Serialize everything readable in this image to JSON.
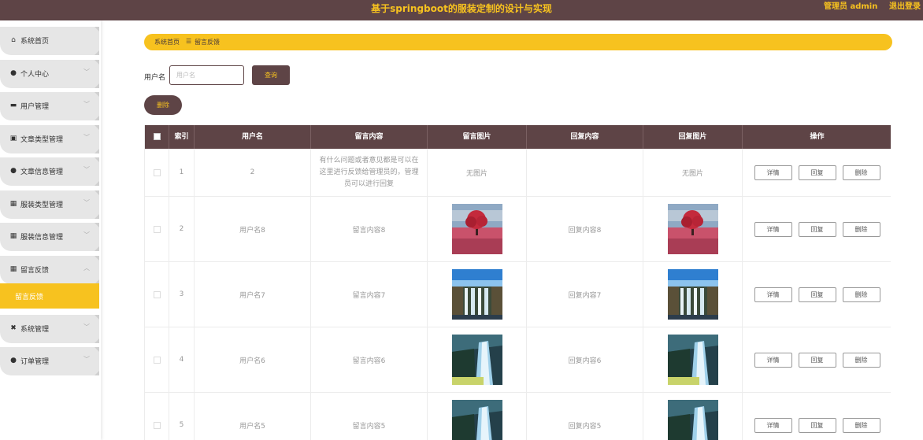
{
  "header": {
    "title": "基于springboot的服装定制的设计与实现",
    "admin": "管理员 admin",
    "logout": "退出登录"
  },
  "sidebar": {
    "items": [
      {
        "label": "系统首页",
        "icon": "home-icon",
        "chevron": ""
      },
      {
        "label": "个人中心",
        "icon": "user-icon",
        "chevron": "﹀"
      },
      {
        "label": "用户管理",
        "icon": "monitor-icon",
        "chevron": "﹀"
      },
      {
        "label": "文章类型管理",
        "icon": "briefcase-icon",
        "chevron": "﹀"
      },
      {
        "label": "文章信息管理",
        "icon": "user-icon",
        "chevron": "﹀"
      },
      {
        "label": "服装类型管理",
        "icon": "grid-icon",
        "chevron": "﹀"
      },
      {
        "label": "服装信息管理",
        "icon": "grid-icon",
        "chevron": "﹀"
      },
      {
        "label": "留言反馈",
        "icon": "grid-icon",
        "chevron": "︿"
      },
      {
        "label": "系统管理",
        "icon": "ticket-icon",
        "chevron": "﹀"
      },
      {
        "label": "订单管理",
        "icon": "pin-icon",
        "chevron": "﹀"
      }
    ],
    "active_sub": "留言反馈"
  },
  "breadcrumb": {
    "home": "系统首页",
    "sep": "☰",
    "current": "留言反馈"
  },
  "search": {
    "label": "用户名",
    "placeholder": "用户名",
    "button": "查询"
  },
  "delete_button": "删除",
  "table": {
    "headers": [
      "索引",
      "用户名",
      "留言内容",
      "留言图片",
      "回复内容",
      "回复图片",
      "操作"
    ],
    "rows": [
      {
        "index": "1",
        "username": "2",
        "content": "有什么问题或者意见都是可以在这里进行反馈给管理员的，管理员可以进行回复",
        "image": "无图片",
        "reply": "",
        "reply_image": "无图片"
      },
      {
        "index": "2",
        "username": "用户名8",
        "content": "留言内容8",
        "image": "tree",
        "reply": "回复内容8",
        "reply_image": "tree"
      },
      {
        "index": "3",
        "username": "用户名7",
        "content": "留言内容7",
        "image": "falls",
        "reply": "回复内容7",
        "reply_image": "falls"
      },
      {
        "index": "4",
        "username": "用户名6",
        "content": "留言内容6",
        "image": "waterfall",
        "reply": "回复内容6",
        "reply_image": "waterfall"
      },
      {
        "index": "5",
        "username": "用户名5",
        "content": "留言内容5",
        "image": "waterfall",
        "reply": "回复内容5",
        "reply_image": "waterfall"
      }
    ],
    "actions": {
      "detail": "详情",
      "reply": "回复",
      "delete": "删除"
    }
  },
  "colors": {
    "brand": "#5e4446",
    "accent": "#f7c21f"
  }
}
